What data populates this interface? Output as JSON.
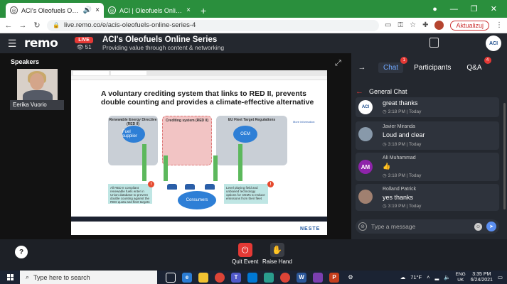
{
  "browser": {
    "tabs": [
      {
        "label": "ACI's Oleofuels Online Series",
        "active": true
      },
      {
        "label": "ACI | Oleofuels Online Series - A",
        "active": false
      }
    ],
    "new_tab": "+",
    "url": "live.remo.co/e/acis-oleofuels-online-series-4",
    "update_label": "Aktualizuj"
  },
  "remo": {
    "logo": "remo",
    "live_label": "LIVE",
    "viewer_count": "51",
    "event_title": "ACI's Oleofuels Online Series",
    "event_subtitle": "Providing value through content & networking",
    "org_logo_text": "ACI"
  },
  "stage": {
    "speakers_label": "Speakers",
    "speaker_name": "Eerika Vuorio",
    "screen_label": "Eerika Vuorio screen",
    "slide": {
      "title": "A voluntary crediting system that links to RED II, prevents double counting and provides a climate-effective alternative",
      "box_red": "Renewable Energy Directive (RED II)",
      "box_mid": "Crediting system (RED II)",
      "box_eu": "EU Fleet Target Regulations",
      "fuel_supplier": "Fuel supplier",
      "oem": "OEM",
      "consumers": "Consumers",
      "teal_left": "All RED II compliant renewable fuels enter in Union database to prevent double counting against the RED quota and fleet targets",
      "teal_right": "Level playing field and unbiased technology options for OEMs to reduce emissions from their fleet",
      "info": "More information:",
      "brand": "NESTE"
    }
  },
  "chat": {
    "tabs": [
      {
        "label": "Chat",
        "badge": "1"
      },
      {
        "label": "Participants",
        "badge": ""
      },
      {
        "label": "Q&A",
        "badge": "4"
      }
    ],
    "section_title": "General Chat",
    "messages": [
      {
        "name": "",
        "text": "great thanks",
        "time": "3:18 PM | Today",
        "avatar": "ACI"
      },
      {
        "name": "Javier Miranda",
        "text": "Loud and clear",
        "time": "3:18 PM | Today",
        "avatar": ""
      },
      {
        "name": "Ali Muhammad",
        "text": "👍",
        "time": "3:18 PM | Today",
        "avatar": "AM"
      },
      {
        "name": "Rolland Patrick",
        "text": "yes thanks",
        "time": "3:19 PM | Today",
        "avatar": ""
      }
    ],
    "input_placeholder": "Type a message"
  },
  "controls": {
    "help": "?",
    "quit_label": "Quit Event",
    "raise_label": "Raise Hand"
  },
  "taskbar": {
    "search_placeholder": "Type here to search",
    "weather": "71°F",
    "lang_top": "ENG",
    "lang_bottom": "UK",
    "time": "3:35 PM",
    "date": "6/24/2021"
  },
  "colors": {
    "tabstrip": "#2a8f3d",
    "remo_bg": "#24282f",
    "live": "#e53935",
    "chat_active": "#6fa8ff"
  }
}
